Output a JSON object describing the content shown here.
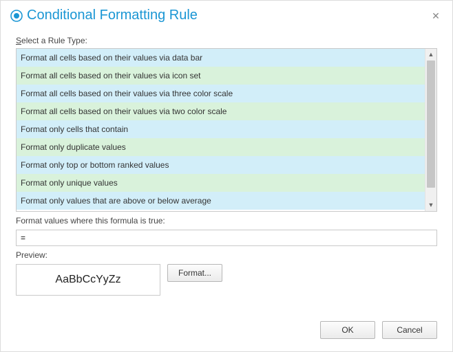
{
  "dialog": {
    "title": "Conditional Formatting Rule",
    "close_glyph": "✕"
  },
  "rule_type": {
    "label_prefix": "S",
    "label_rest": "elect a Rule Type:",
    "items": [
      "Format all cells based on their values via data bar",
      "Format all cells based on their values via icon set",
      "Format all cells based on their values via three color scale",
      "Format all cells based on their values via two color scale",
      "Format only cells that contain",
      "Format only duplicate values",
      "Format only top or bottom ranked values",
      "Format only unique values",
      "Format only values that are above or below average"
    ]
  },
  "formula": {
    "label": "Format values where this formula is true:",
    "value": "="
  },
  "preview": {
    "label": "Preview:",
    "sample": "AaBbCcYyZz",
    "format_button": "Format..."
  },
  "footer": {
    "ok": "OK",
    "cancel": "Cancel"
  },
  "scroll": {
    "up": "▲",
    "down": "▼"
  },
  "colors": {
    "accent": "#1a96d4",
    "row_blue": "#d2eef9",
    "row_green": "#d9f2db"
  }
}
